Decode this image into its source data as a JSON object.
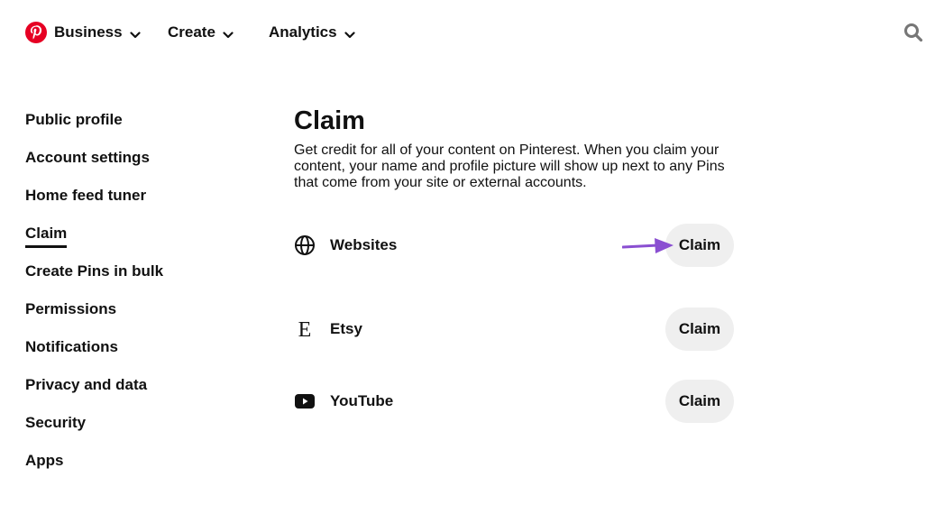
{
  "topnav": {
    "items": [
      {
        "label": "Business"
      },
      {
        "label": "Create"
      },
      {
        "label": "Analytics"
      }
    ],
    "brand_color": "#e60023"
  },
  "sidebar": {
    "items": [
      {
        "label": "Public profile"
      },
      {
        "label": "Account settings"
      },
      {
        "label": "Home feed tuner"
      },
      {
        "label": "Claim",
        "active": true
      },
      {
        "label": "Create Pins in bulk"
      },
      {
        "label": "Permissions"
      },
      {
        "label": "Notifications"
      },
      {
        "label": "Privacy and data"
      },
      {
        "label": "Security"
      },
      {
        "label": "Apps"
      }
    ]
  },
  "main": {
    "title": "Claim",
    "description": "Get credit for all of your content on Pinterest. When you claim your content, your name and profile picture will show up next to any Pins that come from your site or external accounts.",
    "accounts": [
      {
        "label": "Websites",
        "icon": "globe-icon",
        "button": "Claim"
      },
      {
        "label": "Etsy",
        "icon": "etsy-icon",
        "button": "Claim"
      },
      {
        "label": "YouTube",
        "icon": "youtube-icon",
        "button": "Claim"
      }
    ]
  },
  "annotation": {
    "arrow_color": "#8a4fd1"
  }
}
